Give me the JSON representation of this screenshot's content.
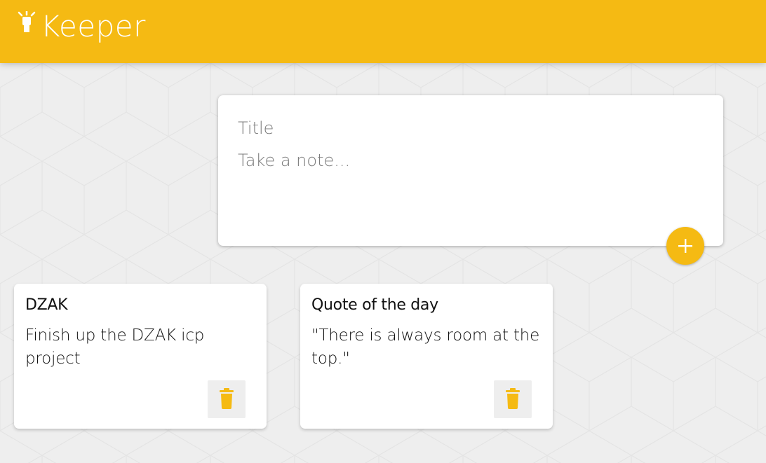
{
  "header": {
    "title": "Keeper",
    "logo_icon": "lightbulb-icon",
    "brand_color": "#f5ba13"
  },
  "create_note": {
    "title_placeholder": "Title",
    "content_placeholder": "Take a note...",
    "add_icon": "plus-icon"
  },
  "notes": [
    {
      "title": "DZAK",
      "content": "Finish up the DZAK icp project",
      "delete_icon": "trash-icon"
    },
    {
      "title": "Quote of the day",
      "content": "\"There is always room at the top.\"",
      "delete_icon": "trash-icon"
    }
  ]
}
